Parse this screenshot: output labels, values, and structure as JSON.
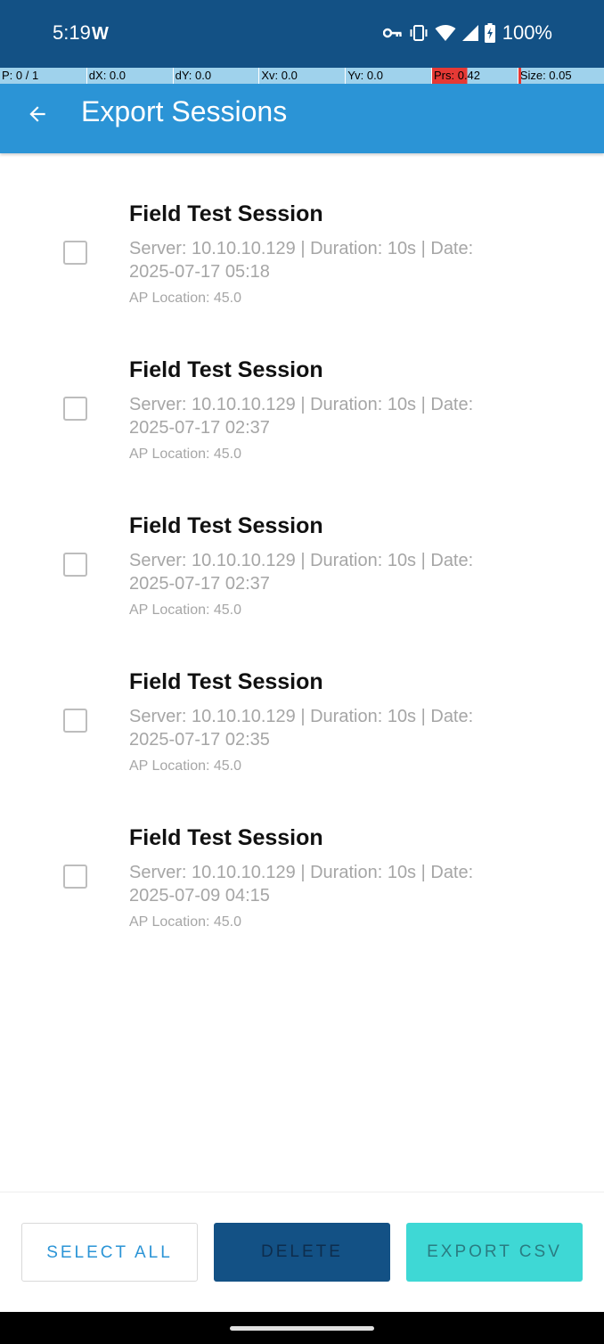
{
  "status_bar": {
    "time": "5:19",
    "app_indicator": "W",
    "battery": "100%",
    "icons": [
      "vpn-key-icon",
      "vibrate-icon",
      "wifi-icon",
      "cell-signal-icon",
      "battery-charging-icon"
    ]
  },
  "debug_overlay": {
    "p": "P: 0 / 1",
    "dx": "dX: 0.0",
    "dy": "dY: 0.0",
    "xv": "Xv: 0.0",
    "yv": "Yv: 0.0",
    "prs": "Prs: 0.42",
    "size": "Size: 0.05"
  },
  "app_bar": {
    "title": "Export Sessions",
    "back_icon": "arrow-back-icon",
    "color": "#2b94d6"
  },
  "sessions": [
    {
      "title": "Field Test Session",
      "details": "Server: 10.10.10.129 | Duration: 10s | Date: 2025-07-17 05:18",
      "location": "AP Location: 45.0",
      "checked": false
    },
    {
      "title": "Field Test Session",
      "details": "Server: 10.10.10.129 | Duration: 10s | Date: 2025-07-17 02:37",
      "location": "AP Location: 45.0",
      "checked": false
    },
    {
      "title": "Field Test Session",
      "details": "Server: 10.10.10.129 | Duration: 10s | Date: 2025-07-17 02:37",
      "location": "AP Location: 45.0",
      "checked": false
    },
    {
      "title": "Field Test Session",
      "details": "Server: 10.10.10.129 | Duration: 10s | Date: 2025-07-17 02:35",
      "location": "AP Location: 45.0",
      "checked": false
    },
    {
      "title": "Field Test Session",
      "details": "Server: 10.10.10.129 | Duration: 10s | Date: 2025-07-09 04:15",
      "location": "AP Location: 45.0",
      "checked": false
    }
  ],
  "actions": {
    "select_all": "SELECT ALL",
    "delete": "DELETE",
    "export_csv": "EXPORT CSV"
  },
  "colors": {
    "status_bar": "#135185",
    "accent": "#2b94d6",
    "delete_button": "#135185",
    "export_button": "#3ed8d5"
  }
}
